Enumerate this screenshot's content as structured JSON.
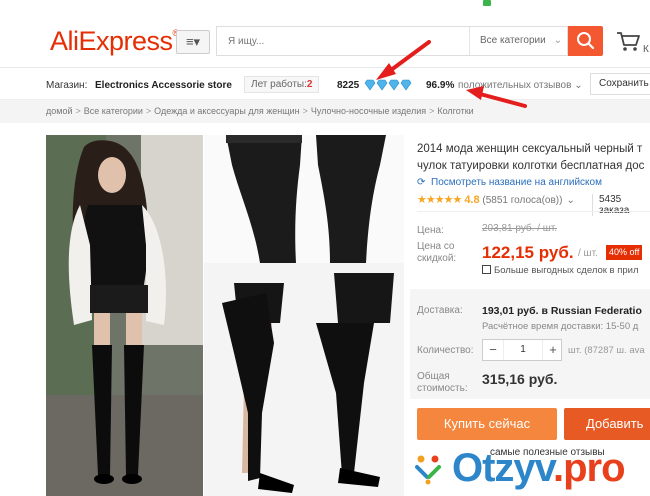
{
  "header": {
    "logo": "AliExpress",
    "logo_mark": "®",
    "menu_label": "≡▾",
    "search_placeholder": "Я ищу...",
    "search_category": "Все категории",
    "cart_label": "К"
  },
  "store": {
    "label": "Магазин:",
    "name": "Electronics Accessorie store",
    "years_label": "Лет работы:",
    "years_value": "2",
    "score": "8225",
    "feedback_percent": "96.9%",
    "feedback_label": "положительных отзывов ⌄",
    "save_label": "Сохранить"
  },
  "breadcrumb": [
    "домой",
    "Все категории",
    "Одежда и аксессуары для женщин",
    "Чулочно-носочные изделия",
    "Колготки"
  ],
  "product": {
    "title": "2014 мода женщин сексуальный черный т чулок татуировки колготки бесплатная дос",
    "translate_label": "Посмотреть название на английском",
    "stars": "★★★★★",
    "rating": "4.8",
    "votes": "(5851 голоса(ов))",
    "orders": "5435 заказа",
    "price_label": "Цена:",
    "old_price": "203,81 руб. / шт.",
    "discount_price_label": "Цена со скидкой:",
    "new_price": "122,15 руб.",
    "unit": "/ шт.",
    "discount_badge": "40% off",
    "deals_label": "Больше выгодных сделок в прил",
    "shipping_label": "Доставка:",
    "shipping_value": "193,01 руб. в Russian Federatio",
    "shipping_time": "Расчётное время доставки: 15-50 д",
    "quantity_label": "Количество:",
    "quantity_value": "1",
    "stock_text": "шт. (87287 ш. ava",
    "total_label": "Общая стоимость:",
    "total_value": "315,16 руб.",
    "buy_label": "Купить сейчас",
    "add_cart_label": "Добавить"
  },
  "watermark": {
    "useful_reviews": "самые полезные отзывы",
    "site": "Otzyv.pro"
  },
  "colors": {
    "brand": "#e62e04",
    "search_button": "#f35831",
    "buy_button": "#f5863d",
    "cart_button": "#e85a23",
    "link": "#2a6ebb",
    "arrow": "#e41d1d",
    "watermark": "#2d86c9"
  }
}
